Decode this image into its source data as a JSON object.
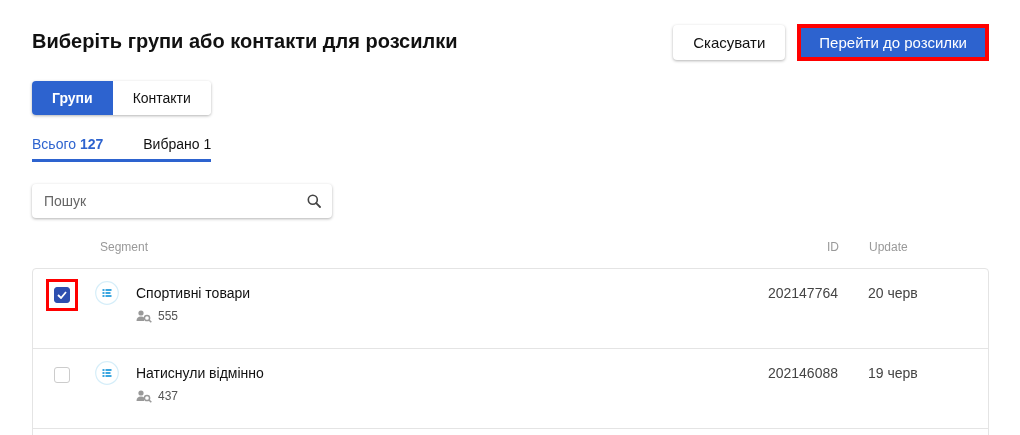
{
  "title": "Виберіть групи або контакти для розсилки",
  "buttons": [
    {
      "kind": "secondary",
      "label": "Скасувати",
      "highlighted": false
    },
    {
      "kind": "primary",
      "label": "Перейти до розсилки",
      "highlighted": true
    }
  ],
  "view_tabs": [
    {
      "label": "Групи",
      "selected": true
    },
    {
      "label": "Контакти",
      "selected": false
    }
  ],
  "count_tabs": [
    {
      "label": "Всього",
      "count": "127",
      "selected": true
    },
    {
      "label": "Вибрано",
      "count": "1",
      "selected": false
    }
  ],
  "search": {
    "placeholder": "Пошук"
  },
  "table": {
    "columns": [
      "Segment",
      "ID",
      "Update"
    ],
    "rows": [
      {
        "name": "Спортивні товари",
        "contacts": "555",
        "id": "202147764",
        "update": "20 черв",
        "checked": true,
        "highlighted": true
      },
      {
        "name": "Натиснули відмінно",
        "contacts": "437",
        "id": "202146088",
        "update": "19 черв",
        "checked": false,
        "highlighted": false
      }
    ]
  }
}
